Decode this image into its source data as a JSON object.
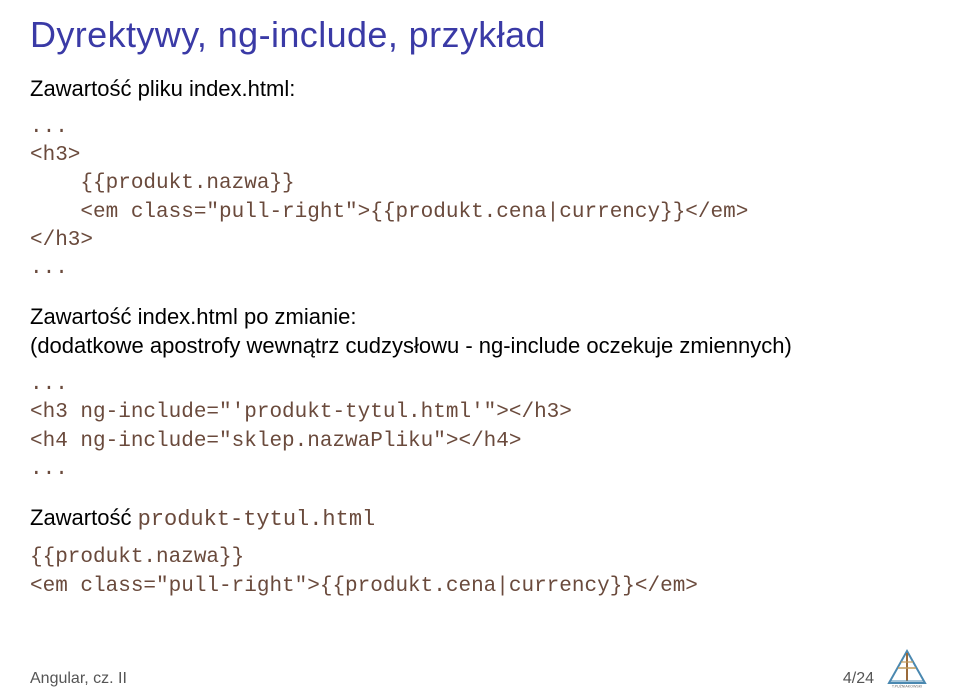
{
  "title": "Dyrektywy, ng-include, przykład",
  "p1": "Zawartość pliku index.html:",
  "code1": "...\n<h3>\n    {{produkt.nazwa}}\n    <em class=\"pull-right\">{{produkt.cena|currency}}</em>\n</h3>\n...",
  "p2": "Zawartość index.html po zmianie:",
  "p2b": "(dodatkowe apostrofy wewnątrz cudzysłowu - ng-include oczekuje zmiennych)",
  "code2": "...\n<h3 ng-include=\"'produkt-tytul.html'\"></h3>\n<h4 ng-include=\"sklep.nazwaPliku\"></h4>\n...",
  "p3": "Zawartość produkt-tytul.html",
  "code3": "{{produkt.nazwa}}\n<em class=\"pull-right\">{{produkt.cena|currency}}</em>",
  "footer_left": "Angular, cz. II",
  "footer_right": "4/24",
  "logo_caption": "T.PUŹNIAKOWSKI"
}
